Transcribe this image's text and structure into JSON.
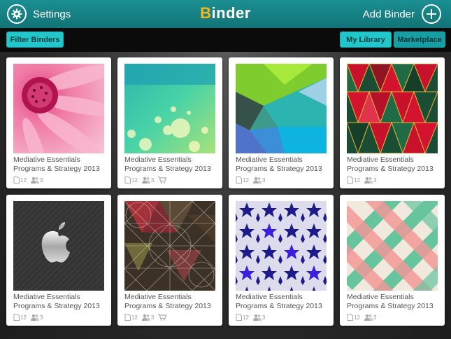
{
  "header": {
    "settings_label": "Settings",
    "logo_first": "B",
    "logo_rest": "inder",
    "add_binder_label": "Add Binder"
  },
  "toolbar": {
    "filter_label": "Filter Binders",
    "my_library_label": "My Library",
    "marketplace_label": "Marketplace"
  },
  "binders": [
    {
      "title": "Mediative Essentials Programs & Strategy 2013",
      "pages": "12",
      "members": "3",
      "cart": false,
      "thumb": "pink-flower"
    },
    {
      "title": "Mediative Essentials Programs & Strategy 2013",
      "pages": "12",
      "members": "3",
      "cart": true,
      "thumb": "bokeh"
    },
    {
      "title": "Mediative Essentials Programs & Strategy 2013",
      "pages": "12",
      "members": "3",
      "cart": false,
      "thumb": "geometric-green"
    },
    {
      "title": "Mediative Essentials Programs & Strategy 2013",
      "pages": "12",
      "members": "3",
      "cart": false,
      "thumb": "red-triangles"
    },
    {
      "title": "Mediative Essentials Programs & Strategy 2013",
      "pages": "12",
      "members": "3",
      "cart": false,
      "thumb": "apple-logo"
    },
    {
      "title": "Mediative Essentials Programs & Strategy 2013",
      "pages": "12",
      "members": "3",
      "cart": true,
      "thumb": "triangle-mesh"
    },
    {
      "title": "Mediative Essentials Programs & Strategy 2013",
      "pages": "12",
      "members": "3",
      "cart": false,
      "thumb": "blue-stars"
    },
    {
      "title": "Mediative Essentials Programs & Strategy 2013",
      "pages": "12",
      "members": "3",
      "cart": false,
      "thumb": "plaid"
    }
  ],
  "colors": {
    "header_teal": "#158a8d",
    "button_teal": "#22c7cc",
    "logo_accent": "#f4b71c"
  },
  "icons": {
    "settings": "gear-icon",
    "add": "plus-icon",
    "pages": "document-icon",
    "members": "users-icon",
    "cart": "cart-icon"
  }
}
